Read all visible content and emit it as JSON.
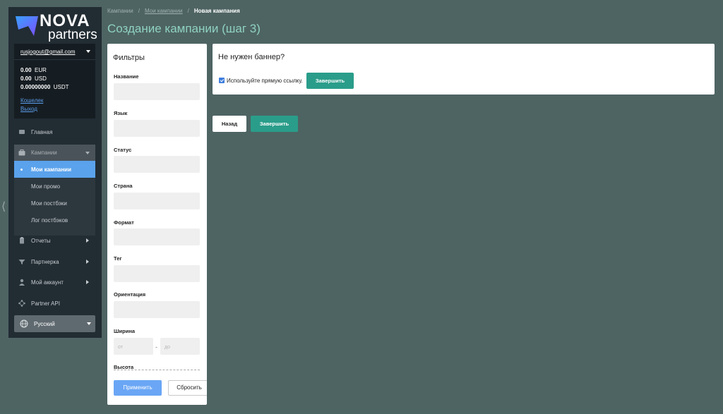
{
  "brand": {
    "name_top": "NOVA",
    "name_bottom": "partners"
  },
  "account": {
    "email": "rusjogout@gmail.com",
    "balances": [
      {
        "amount": "0.00",
        "currency": "EUR"
      },
      {
        "amount": "0.00",
        "currency": "USD"
      },
      {
        "amount": "0.00000000",
        "currency": "USDT"
      }
    ],
    "wallet_link": "Кошелек",
    "logout_link": "Выход"
  },
  "nav": {
    "home": "Главная",
    "campaigns": "Кампании",
    "campaigns_sub": [
      "Мои кампании",
      "Мои промо",
      "Мои постбэки",
      "Лог постбэков"
    ],
    "reports": "Отчеты",
    "partnership": "Партнерка",
    "my_account": "Мой аккаунт",
    "partner_api": "Partner API",
    "language": "Русский"
  },
  "breadcrumb": {
    "root": "Кампании",
    "parent": "Мои кампании",
    "current": "Новая кампания"
  },
  "page_title": "Создание кампании (шаг 3)",
  "filters": {
    "title": "Фильтры",
    "fields": [
      "Название",
      "Язык",
      "Статус",
      "Страна",
      "Формат",
      "Тег",
      "Ориентация",
      "Ширина",
      "Высота"
    ],
    "width_from_placeholder": "от",
    "width_to_placeholder": "до",
    "range_dash": "-",
    "apply_label": "Применить",
    "reset_label": "Сбросить"
  },
  "banner": {
    "title": "Не нужен баннер?",
    "direct_link_label": "Используйте прямую ссылку.",
    "direct_link_checked": true,
    "finish_label": "Завершить"
  },
  "actions": {
    "back_label": "Назад",
    "finish_label": "Завершить"
  },
  "colors": {
    "accent_teal": "#2a9d8a",
    "active_blue": "#5aa2ec",
    "apply_blue": "#6aa6f5",
    "background": "#4e6463",
    "sidebar": "#222c33"
  }
}
